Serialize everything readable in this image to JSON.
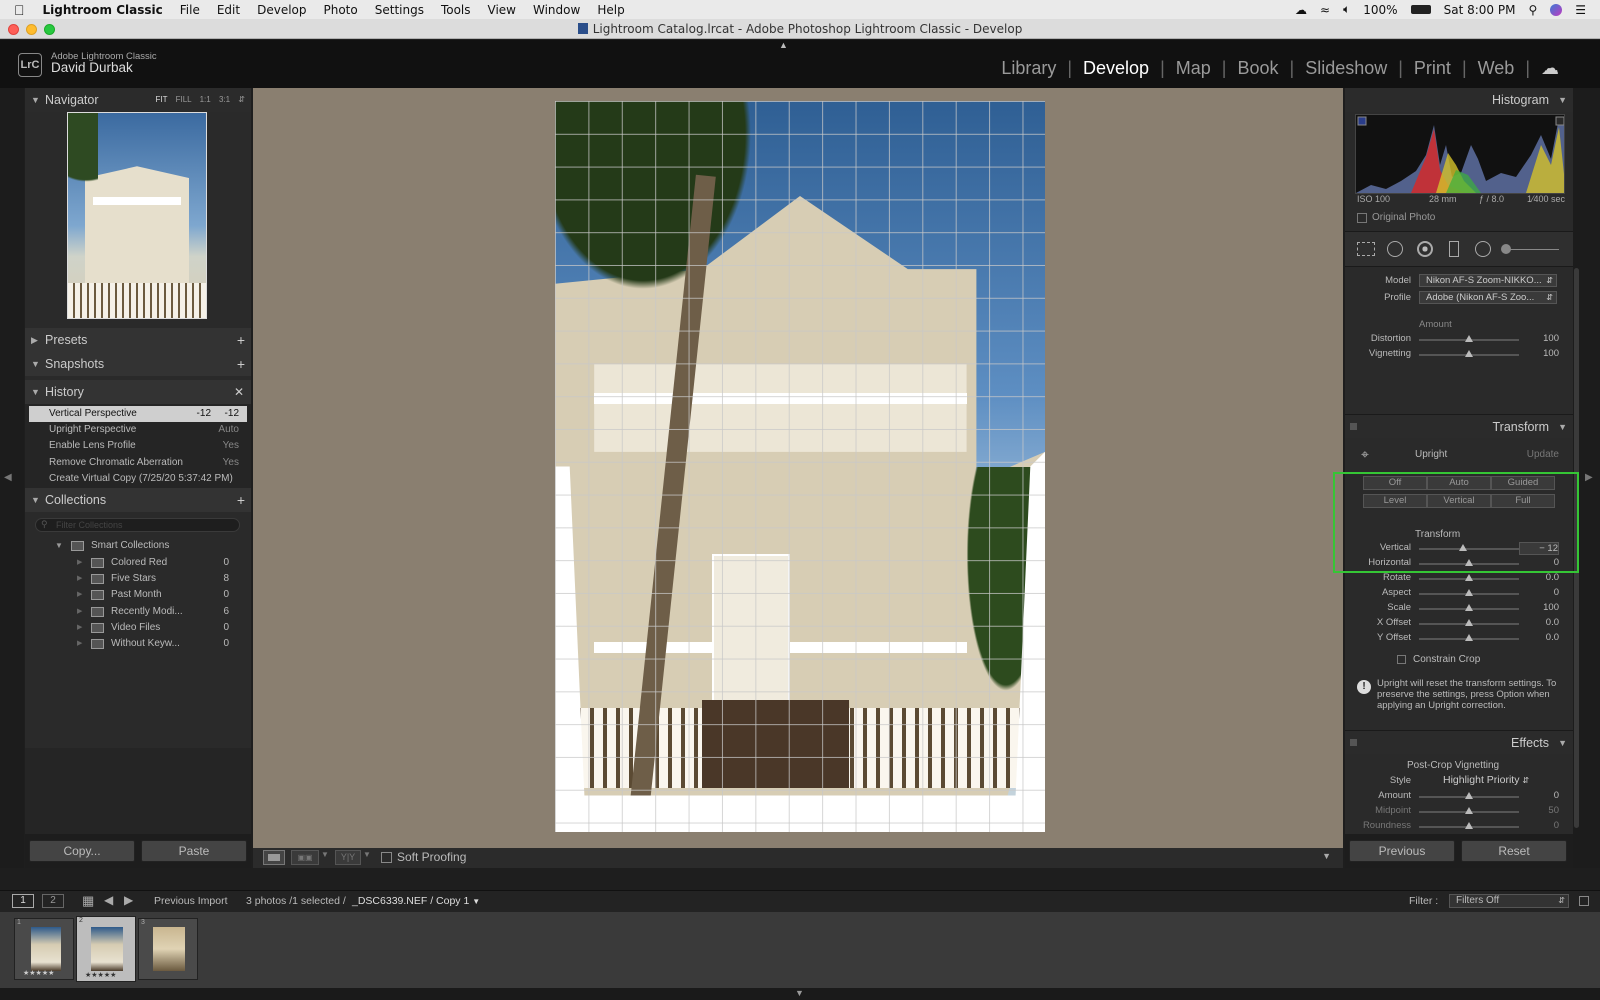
{
  "menubar": {
    "app": "Lightroom Classic",
    "items": [
      "File",
      "Edit",
      "Develop",
      "Photo",
      "Settings",
      "Tools",
      "View",
      "Window",
      "Help"
    ],
    "battery": "100%",
    "clock": "Sat 8:00 PM"
  },
  "window": {
    "title": "Lightroom Catalog.lrcat - Adobe Photoshop Lightroom Classic - Develop"
  },
  "identity": {
    "badge": "LrC",
    "product": "Adobe Lightroom Classic",
    "user": "David Durbak"
  },
  "modules": [
    "Library",
    "Develop",
    "Map",
    "Book",
    "Slideshow",
    "Print",
    "Web"
  ],
  "active_module": "Develop",
  "navigator": {
    "title": "Navigator",
    "zoom": [
      "FIT",
      "FILL",
      "1:1",
      "3:1"
    ]
  },
  "presets": {
    "title": "Presets"
  },
  "snapshots": {
    "title": "Snapshots"
  },
  "history": {
    "title": "History",
    "items": [
      {
        "label": "Vertical Perspective",
        "a": "-12",
        "b": "-12"
      },
      {
        "label": "Upright Perspective",
        "a": "",
        "b": "Auto"
      },
      {
        "label": "Enable Lens Profile",
        "a": "",
        "b": "Yes"
      },
      {
        "label": "Remove Chromatic Aberration",
        "a": "",
        "b": "Yes"
      },
      {
        "label": "Create Virtual Copy (7/25/20 5:37:42 PM)",
        "a": "",
        "b": ""
      }
    ]
  },
  "collections": {
    "title": "Collections",
    "filter_placeholder": "Filter Collections",
    "smart_group": "Smart Collections",
    "items": [
      {
        "label": "Colored Red",
        "count": "0"
      },
      {
        "label": "Five Stars",
        "count": "8"
      },
      {
        "label": "Past Month",
        "count": "0"
      },
      {
        "label": "Recently Modi...",
        "count": "6"
      },
      {
        "label": "Video Files",
        "count": "0"
      },
      {
        "label": "Without Keyw...",
        "count": "0"
      }
    ]
  },
  "left_buttons": {
    "copy": "Copy...",
    "paste": "Paste"
  },
  "toolbar": {
    "soft_proofing": "Soft Proofing"
  },
  "histogram": {
    "title": "Histogram",
    "iso": "ISO 100",
    "focal": "28 mm",
    "aperture": "ƒ / 8.0",
    "shutter": "1⁄400 sec",
    "original": "Original Photo"
  },
  "lens": {
    "model_label": "Model",
    "model_value": "Nikon AF-S Zoom-NIKKO...",
    "profile_label": "Profile",
    "profile_value": "Adobe (Nikon AF-S Zoo...",
    "amount_label": "Amount",
    "sliders": [
      {
        "label": "Distortion",
        "value": "100",
        "pos": 0.5
      },
      {
        "label": "Vignetting",
        "value": "100",
        "pos": 0.5
      }
    ]
  },
  "transform": {
    "title": "Transform",
    "upright": "Upright",
    "update": "Update",
    "buttons_row1": [
      "Off",
      "Auto",
      "Guided"
    ],
    "buttons_row2": [
      "Level",
      "Vertical",
      "Full"
    ],
    "section": "Transform",
    "sliders": [
      {
        "label": "Vertical",
        "value": "− 12",
        "pos": 0.44
      },
      {
        "label": "Horizontal",
        "value": "0",
        "pos": 0.5
      },
      {
        "label": "Rotate",
        "value": "0.0",
        "pos": 0.5
      },
      {
        "label": "Aspect",
        "value": "0",
        "pos": 0.5
      },
      {
        "label": "Scale",
        "value": "100",
        "pos": 0.5
      },
      {
        "label": "X Offset",
        "value": "0.0",
        "pos": 0.5
      },
      {
        "label": "Y Offset",
        "value": "0.0",
        "pos": 0.5
      }
    ],
    "constrain": "Constrain Crop",
    "info": "Upright will reset the transform settings. To preserve the settings, press Option when applying an Upright correction."
  },
  "effects": {
    "title": "Effects",
    "post_crop": "Post-Crop Vignetting",
    "style_label": "Style",
    "style_value": "Highlight Priority",
    "sliders": [
      {
        "label": "Amount",
        "value": "0",
        "pos": 0.5
      },
      {
        "label": "Midpoint",
        "value": "50",
        "pos": 0.5
      },
      {
        "label": "Roundness",
        "value": "0",
        "pos": 0.5
      }
    ]
  },
  "right_buttons": {
    "previous": "Previous",
    "reset": "Reset"
  },
  "filmstrip": {
    "screen1": "1",
    "screen2": "2",
    "source": "Previous Import",
    "count": "3 photos /1 selected /",
    "file": "_DSC6339.NEF / Copy 1",
    "filter_label": "Filter :",
    "filter_value": "Filters Off",
    "thumbs": [
      "1",
      "2",
      "3"
    ]
  },
  "colors": {
    "highlight": "#35c635",
    "panel_bg": "#2a2a2a",
    "canvas_bg": "#8a7f70"
  }
}
